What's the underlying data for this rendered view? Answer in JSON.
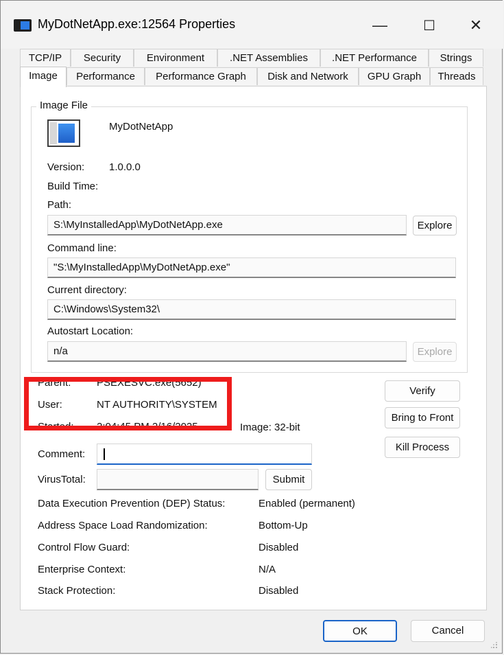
{
  "window": {
    "title": "MyDotNetApp.exe:12564 Properties",
    "minimize_glyph": "—",
    "maximize_glyph": "☐",
    "close_glyph": "✕"
  },
  "tabs_row1": [
    "TCP/IP",
    "Security",
    "Environment",
    ".NET Assemblies",
    ".NET Performance",
    "Strings"
  ],
  "tabs_row2": [
    "Image",
    "Performance",
    "Performance Graph",
    "Disk and Network",
    "GPU Graph",
    "Threads"
  ],
  "image_file": {
    "group_label": "Image File",
    "app_name": "MyDotNetApp",
    "version_label": "Version:",
    "version_value": "1.0.0.0",
    "build_time_label": "Build Time:",
    "path_label": "Path:",
    "path_value": "S:\\MyInstalledApp\\MyDotNetApp.exe",
    "explore_label": "Explore",
    "command_line_label": "Command line:",
    "command_line_value": "\"S:\\MyInstalledApp\\MyDotNetApp.exe\"",
    "current_dir_label": "Current directory:",
    "current_dir_value": "C:\\Windows\\System32\\",
    "autostart_label": "Autostart Location:",
    "autostart_value": "n/a",
    "autostart_explore_label": "Explore"
  },
  "process": {
    "parent_label": "Parent:",
    "parent_value": "PSEXESVC.exe(5652)",
    "user_label": "User:",
    "user_value": "NT AUTHORITY\\SYSTEM",
    "started_label": "Started:",
    "started_value": "2:04:45 PM   2/16/2025",
    "image_bitness": "Image: 32-bit",
    "verify_label": "Verify",
    "bring_front_label": "Bring to Front",
    "kill_label": "Kill Process",
    "comment_label": "Comment:",
    "comment_value": "",
    "virustotal_label": "VirusTotal:",
    "virustotal_value": "",
    "submit_label": "Submit"
  },
  "security_info": [
    {
      "label": "Data Execution Prevention (DEP) Status:",
      "value": "Enabled (permanent)"
    },
    {
      "label": "Address Space Load Randomization:",
      "value": "Bottom-Up"
    },
    {
      "label": "Control Flow Guard:",
      "value": "Disabled"
    },
    {
      "label": "Enterprise Context:",
      "value": "N/A"
    },
    {
      "label": "Stack Protection:",
      "value": "Disabled"
    }
  ],
  "footer": {
    "ok_label": "OK",
    "cancel_label": "Cancel"
  },
  "colors": {
    "highlight": "#ee1c1c",
    "accent": "#1a64c8"
  },
  "icons": {
    "app": "window-app-icon",
    "exe": "executable-icon",
    "grip": "resize-grip-icon"
  }
}
